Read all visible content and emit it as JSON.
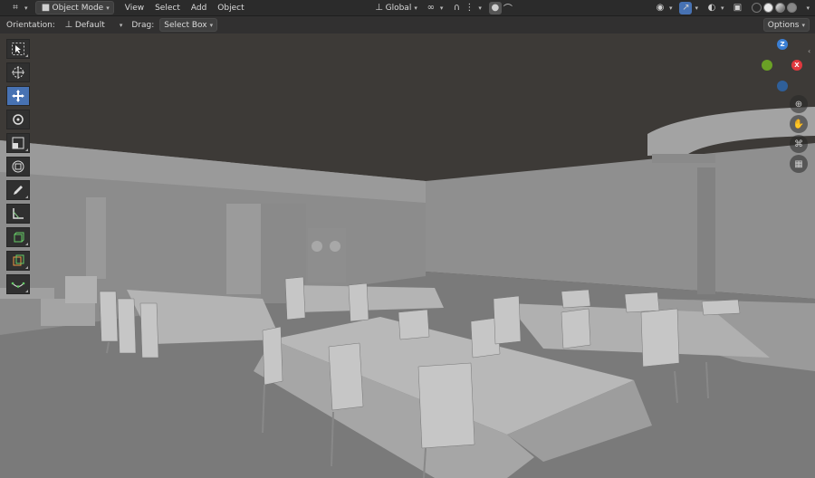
{
  "header": {
    "editor_icon": "3d-viewport-icon",
    "mode_label": "Object Mode",
    "menus": [
      "View",
      "Select",
      "Add",
      "Object"
    ],
    "transform_orientation": "Global",
    "snap_icon": "magnet-icon",
    "proportional_icon": "proportional-edit-icon"
  },
  "tool_settings": {
    "orientation_label": "Orientation:",
    "orientation_value": "Default",
    "drag_label": "Drag:",
    "drag_value": "Select Box",
    "options_label": "Options"
  },
  "toolbar": {
    "tools": [
      "select-box",
      "cursor",
      "move",
      "rotate",
      "scale",
      "transform",
      "annotate",
      "measure",
      "add-cube",
      "add-object",
      "curve"
    ]
  },
  "gizmo": {
    "z": "Z",
    "x": "X",
    "y": "",
    "neg": "",
    "colors": {
      "x": "#e0383e",
      "y": "#6aa125",
      "z": "#3b7fd4"
    }
  },
  "colors": {
    "accent": "#4772b3",
    "background": "#3d3a37",
    "floor": "#7b7b7b"
  }
}
